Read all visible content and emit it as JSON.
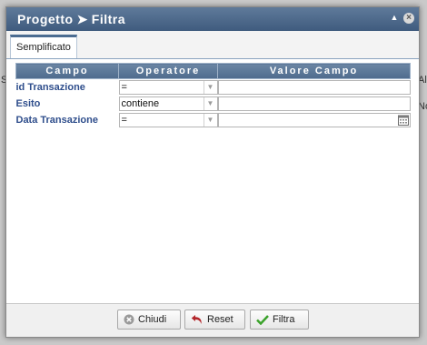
{
  "window": {
    "title_part1": "Progetto",
    "title_part2": "Filtra",
    "collapse_icon": "collapse-icon",
    "close_icon": "close-icon"
  },
  "background": {
    "left_fragment": "S",
    "right_fragment_1": "All",
    "right_fragment_2": "No"
  },
  "tabs": [
    {
      "label": "Semplificato",
      "active": true
    }
  ],
  "filter_table": {
    "headers": [
      "Campo",
      "Operatore",
      "Valore Campo"
    ],
    "rows": [
      {
        "field": "id Transazione",
        "operator": "=",
        "value": "",
        "has_calendar": false
      },
      {
        "field": "Esito",
        "operator": "contiene",
        "value": "",
        "has_calendar": false
      },
      {
        "field": "Data Transazione",
        "operator": "=",
        "value": "",
        "has_calendar": true
      }
    ]
  },
  "buttons": {
    "close": {
      "label": "Chiudi",
      "icon": "cancel-icon"
    },
    "reset": {
      "label": "Reset",
      "icon": "undo-arrow-icon"
    },
    "filter": {
      "label": "Filtra",
      "icon": "checkmark-icon"
    }
  },
  "colors": {
    "titlebar": "#4b6c91",
    "header": "#5c7898",
    "label": "#2f4e8c",
    "check": "#3aa22a",
    "reset_arrow": "#b3262a"
  }
}
